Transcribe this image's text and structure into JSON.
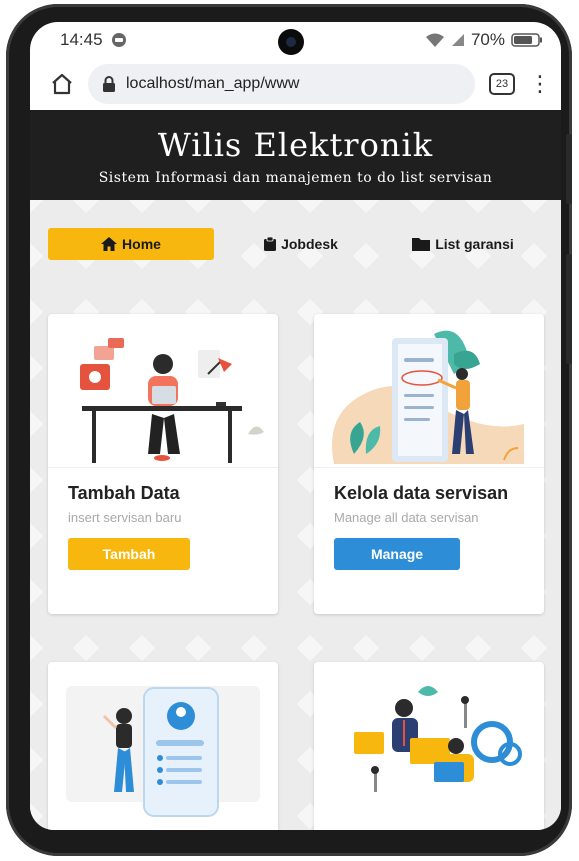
{
  "status_bar": {
    "time": "14:45",
    "battery": "70%"
  },
  "browser": {
    "url": "localhost/man_app/www",
    "tab_count": "23"
  },
  "app": {
    "title": "Wilis Elektronik",
    "subtitle": "Sistem Informasi dan manajemen to do list servisan"
  },
  "nav": {
    "home": "Home",
    "jobdesk": "Jobdesk",
    "garansi": "List garansi"
  },
  "cards": [
    {
      "title": "Tambah Data",
      "subtitle": "insert servisan baru",
      "button": "Tambah"
    },
    {
      "title": "Kelola data servisan",
      "subtitle": "Manage all data servisan",
      "button": "Manage"
    }
  ],
  "colors": {
    "accent": "#f7b70e",
    "primary": "#2d8dd6",
    "header": "#1f1f1f"
  },
  "icons": [
    "home-icon",
    "browser-home-icon",
    "lock-icon",
    "clipboard-icon",
    "folder-icon",
    "wifi-icon",
    "signal-icon",
    "battery-icon",
    "menu-dots-icon"
  ]
}
